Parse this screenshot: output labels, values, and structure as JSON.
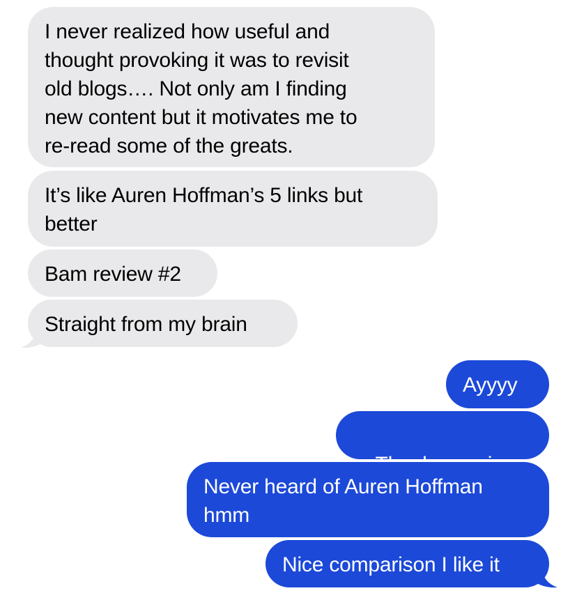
{
  "colors": {
    "incoming_bubble": "#e9e9eb",
    "outgoing_bubble": "#1c49d8",
    "incoming_text": "#000000",
    "outgoing_text": "#ffffff"
  },
  "conversation": {
    "incoming": [
      {
        "text": "I never realized how useful and\nthought provoking it was to revisit\nold blogs…. Not only am I finding\nnew content but it motivates me to\nre-read some of the greats."
      },
      {
        "text": "It’s like Auren Hoffman’s 5 links but\nbetter"
      },
      {
        "text": "Bam review #2"
      },
      {
        "text": "Straight from my brain"
      }
    ],
    "outgoing": [
      {
        "text": "Ayyyy"
      },
      {
        "text": "Thank you sir",
        "emoji_icon": "folded-hands-icon"
      },
      {
        "text": "Never heard of Auren Hoffman\nhmm"
      },
      {
        "text": "Nice comparison I like it"
      }
    ]
  }
}
